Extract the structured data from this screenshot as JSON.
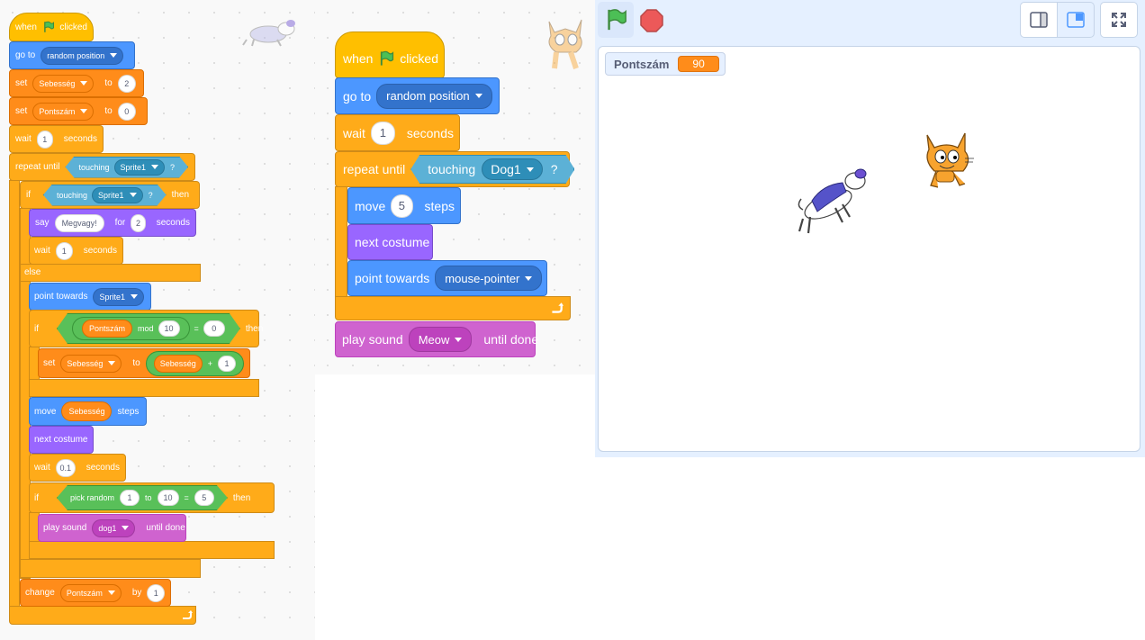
{
  "left_script": {
    "when_flag": {
      "prefix": "when",
      "suffix": "clicked"
    },
    "goto": {
      "label": "go to",
      "value": "random position"
    },
    "set1": {
      "label": "set",
      "var": "Sebesség",
      "to": "to",
      "value": "2"
    },
    "set2": {
      "label": "set",
      "var": "Pontszám",
      "to": "to",
      "value": "0"
    },
    "wait1": {
      "label": "wait",
      "value": "1",
      "suffix": "seconds"
    },
    "repeat": {
      "label": "repeat until",
      "touching": "touching",
      "target": "Sprite1",
      "q": "?"
    },
    "if1": {
      "label": "if",
      "touching": "touching",
      "target": "Sprite1",
      "q": "?",
      "then": "then"
    },
    "say": {
      "label": "say",
      "message": "Megvagy!",
      "for": "for",
      "value": "2",
      "suffix": "seconds"
    },
    "wait2": {
      "label": "wait",
      "value": "1",
      "suffix": "seconds"
    },
    "else": "else",
    "point": {
      "label": "point towards",
      "target": "Sprite1"
    },
    "if2": {
      "label": "if",
      "var": "Pontszám",
      "mod": "mod",
      "num": "10",
      "eq": "=",
      "val": "0",
      "then": "then"
    },
    "set3": {
      "label": "set",
      "var": "Sebesség",
      "to": "to",
      "reporter": "Sebesség",
      "plus": "+",
      "value": "1"
    },
    "move": {
      "label": "move",
      "var": "Sebesség",
      "suffix": "steps"
    },
    "next": {
      "label": "next costume"
    },
    "wait3": {
      "label": "wait",
      "value": "0.1",
      "suffix": "seconds"
    },
    "if3": {
      "label": "if",
      "random": "pick random",
      "from": "1",
      "to": "to",
      "till": "10",
      "eq": "=",
      "val": "5",
      "then": "then"
    },
    "play": {
      "label": "play sound",
      "sound": "dog1",
      "suffix": "until done"
    },
    "change": {
      "label": "change",
      "var": "Pontszám",
      "by": "by",
      "value": "1"
    }
  },
  "right_script": {
    "when_flag": {
      "prefix": "when",
      "suffix": "clicked"
    },
    "goto": {
      "label": "go to",
      "value": "random position"
    },
    "wait": {
      "label": "wait",
      "value": "1",
      "suffix": "seconds"
    },
    "repeat": {
      "label": "repeat until",
      "touching": "touching",
      "target": "Dog1",
      "q": "?"
    },
    "move": {
      "label": "move",
      "value": "5",
      "suffix": "steps"
    },
    "next": {
      "label": "next costume"
    },
    "point": {
      "label": "point towards",
      "target": "mouse-pointer"
    },
    "play": {
      "label": "play sound",
      "sound": "Meow",
      "suffix": "until done"
    }
  },
  "stage": {
    "monitor": {
      "name": "Pontszám",
      "value": "90"
    }
  },
  "icons": {
    "green_flag": "green-flag-icon",
    "stop": "stop-icon",
    "small_stage": "small-stage-icon",
    "normal_stage": "normal-stage-icon",
    "fullscreen": "fullscreen-icon"
  },
  "colors": {
    "events": "#FFBF00",
    "motion": "#4C97FF",
    "control": "#FFAB19",
    "variables": "#FF8C1A",
    "looks": "#9966FF",
    "sound": "#CF63CF",
    "sensing": "#5CB1D6",
    "operators": "#59C059"
  }
}
